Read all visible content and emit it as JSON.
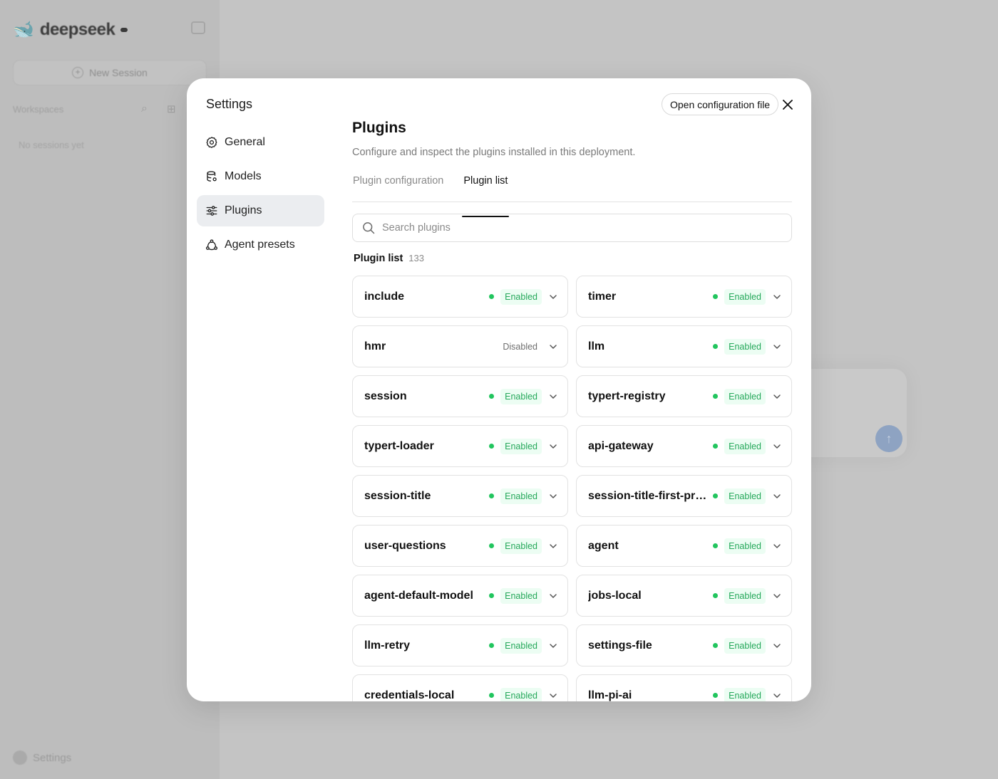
{
  "background": {
    "logo_text": "deepseek",
    "logo_tag": "",
    "new_session_label": "New Session",
    "workspaces_label": "Workspaces",
    "no_sessions_label": "No sessions yet",
    "settings_label": "Settings"
  },
  "modal": {
    "title": "Settings",
    "open_config_label": "Open configuration file",
    "nav": [
      {
        "label": "General",
        "icon": "gear-icon",
        "active": false
      },
      {
        "label": "Models",
        "icon": "database-icon",
        "active": false
      },
      {
        "label": "Plugins",
        "icon": "sliders-icon",
        "active": true
      },
      {
        "label": "Agent presets",
        "icon": "agent-icon",
        "active": false
      }
    ],
    "content": {
      "title": "Plugins",
      "description": "Configure and inspect the plugins installed in this deployment.",
      "tabs": [
        {
          "label": "Plugin configuration",
          "active": false
        },
        {
          "label": "Plugin list",
          "active": true
        }
      ],
      "search_placeholder": "Search plugins",
      "list_label": "Plugin list",
      "list_count": "133",
      "status_color_enabled": "#22c55e",
      "plugins": [
        {
          "name": "include",
          "status": "Enabled"
        },
        {
          "name": "timer",
          "status": "Enabled"
        },
        {
          "name": "hmr",
          "status": "Disabled"
        },
        {
          "name": "llm",
          "status": "Enabled"
        },
        {
          "name": "session",
          "status": "Enabled"
        },
        {
          "name": "typert-registry",
          "status": "Enabled"
        },
        {
          "name": "typert-loader",
          "status": "Enabled"
        },
        {
          "name": "api-gateway",
          "status": "Enabled"
        },
        {
          "name": "session-title",
          "status": "Enabled"
        },
        {
          "name": "session-title-first-pr…",
          "status": "Enabled"
        },
        {
          "name": "user-questions",
          "status": "Enabled"
        },
        {
          "name": "agent",
          "status": "Enabled"
        },
        {
          "name": "agent-default-model",
          "status": "Enabled"
        },
        {
          "name": "jobs-local",
          "status": "Enabled"
        },
        {
          "name": "llm-retry",
          "status": "Enabled"
        },
        {
          "name": "settings-file",
          "status": "Enabled"
        },
        {
          "name": "credentials-local",
          "status": "Enabled"
        },
        {
          "name": "llm-pi-ai",
          "status": "Enabled"
        }
      ]
    }
  }
}
